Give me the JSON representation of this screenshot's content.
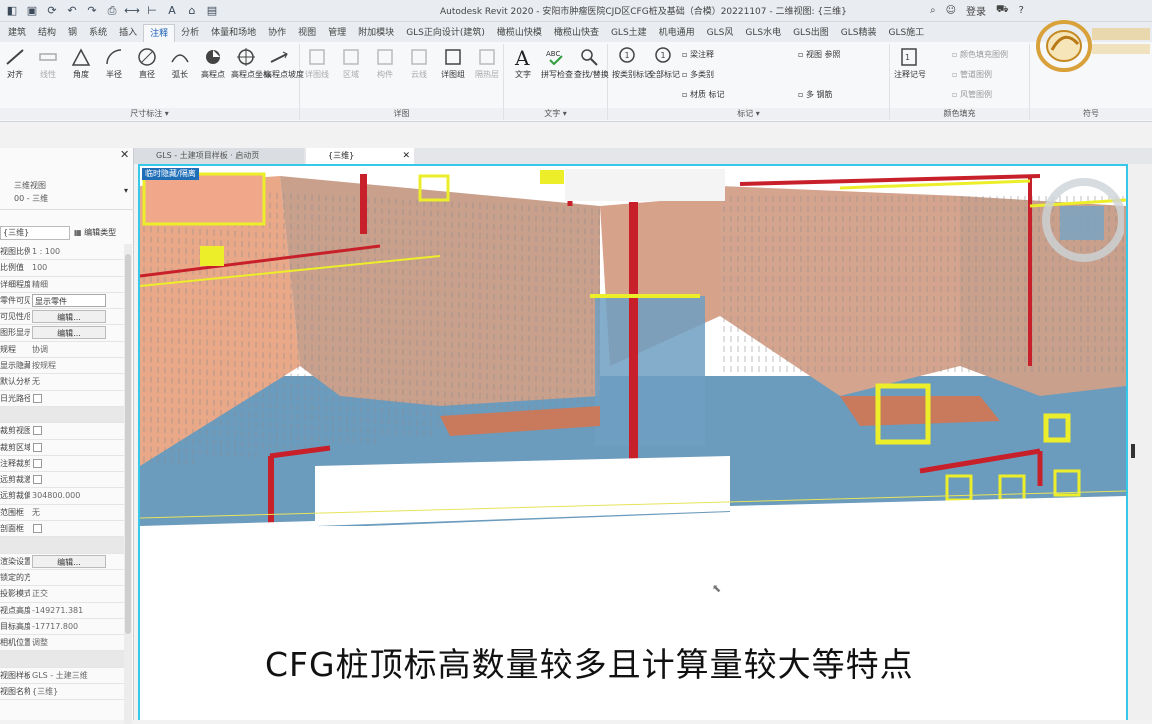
{
  "window": {
    "title": "Autodesk Revit 2020 - 安阳市肿瘤医院CJD区CFG桩及基础（合模）20221107 - 二维视图: {三维}",
    "user": "登录"
  },
  "ribbon_tabs": [
    "建筑",
    "结构",
    "钢",
    "系统",
    "插入",
    "注释",
    "分析",
    "体量和场地",
    "协作",
    "视图",
    "管理",
    "附加模块",
    "GLS正向设计(建筑)",
    "橄榄山快模",
    "橄榄山快查",
    "GLS土建",
    "机电通用",
    "GLS风",
    "GLS水电",
    "GLS出图",
    "GLS精装",
    "GLS施工"
  ],
  "active_tab": "注释",
  "ribbon": {
    "dimension_group": {
      "label": "尺寸标注 ▾",
      "buttons": [
        "对齐",
        "线性",
        "角度",
        "半径",
        "直径",
        "弧长",
        "高程点",
        "高程点坐标",
        "高程点坡度"
      ]
    },
    "detail_group": {
      "label": "详图",
      "buttons": [
        "详图线",
        "区域",
        "构件",
        "云线",
        "详图组",
        "隔热层"
      ]
    },
    "text_group": {
      "label": "文字 ▾",
      "buttons": [
        "文字",
        "拼写检查",
        "查找/替换"
      ]
    },
    "tag_group": {
      "label": "标记 ▾",
      "buttons": [
        "按类别标记",
        "全部标记"
      ],
      "small": [
        "梁注释",
        "多类别",
        "材质 标记",
        "视图 参照",
        "多 钢筋"
      ]
    },
    "notes_group": {
      "label": "颜色填充",
      "buttons": [
        "注释记号"
      ],
      "small": [
        "颜色填充图例",
        "管道图例",
        "风管图例"
      ]
    },
    "symbol_group": {
      "label": "符号"
    }
  },
  "properties": {
    "type_name": "三维视图",
    "type_sub": "00 - 三维",
    "filter": "{三维}",
    "edit_type": "编辑类型",
    "rows": [
      {
        "k": "视图比例",
        "v": "1 : 100",
        "kind": "text"
      },
      {
        "k": "比例值",
        "v": "100",
        "kind": "text"
      },
      {
        "k": "详细程度",
        "v": "精细",
        "kind": "text"
      },
      {
        "k": "零件可见性",
        "v": "显示零件",
        "kind": "box"
      },
      {
        "k": "可见性/图形替换",
        "v": "编辑...",
        "kind": "btn"
      },
      {
        "k": "图形显示选项",
        "v": "编辑...",
        "kind": "btn"
      },
      {
        "k": "规程",
        "v": "协调",
        "kind": "text"
      },
      {
        "k": "显示隐藏线",
        "v": "按规程",
        "kind": "text"
      },
      {
        "k": "默认分析显示",
        "v": "无",
        "kind": "text"
      },
      {
        "k": "日光路径",
        "v": "",
        "kind": "check"
      },
      {
        "k": "",
        "v": "",
        "kind": "section"
      },
      {
        "k": "裁剪视图",
        "v": "",
        "kind": "check"
      },
      {
        "k": "裁剪区域可见",
        "v": "",
        "kind": "check"
      },
      {
        "k": "注释裁剪",
        "v": "",
        "kind": "check"
      },
      {
        "k": "远剪裁激活",
        "v": "",
        "kind": "check"
      },
      {
        "k": "远剪裁偏移",
        "v": "304800.000",
        "kind": "text"
      },
      {
        "k": "范围框",
        "v": "无",
        "kind": "text"
      },
      {
        "k": "剖面框",
        "v": "",
        "kind": "check"
      },
      {
        "k": "",
        "v": "",
        "kind": "section"
      },
      {
        "k": "渲染设置",
        "v": "编辑...",
        "kind": "btn"
      },
      {
        "k": "锁定的方向",
        "v": "",
        "kind": "text"
      },
      {
        "k": "投影模式",
        "v": "正交",
        "kind": "text"
      },
      {
        "k": "视点高度",
        "v": "-149271.381",
        "kind": "text"
      },
      {
        "k": "目标高度",
        "v": "-17717.800",
        "kind": "text"
      },
      {
        "k": "相机位置",
        "v": "调整",
        "kind": "text"
      },
      {
        "k": "",
        "v": "",
        "kind": "section"
      },
      {
        "k": "视图样板",
        "v": "GLS - 土建三维",
        "kind": "text"
      },
      {
        "k": "视图名称",
        "v": "{三维}",
        "kind": "text"
      }
    ]
  },
  "view_tabs": [
    {
      "label": "GLS - 土建项目样板 · 启动页",
      "active": false
    },
    {
      "label": "{三维}",
      "active": true
    }
  ],
  "viewport": {
    "label": "临时隐藏/隔离",
    "caption": "CFG桩顶标高数量较多且计算量较大等特点"
  },
  "colors": {
    "accent": "#35c8e8",
    "soil": "#f1a88a",
    "pile_gray": "#b9b9b9",
    "ground_blue": "#5b8fb5",
    "beam_red": "#c8202a",
    "marker_yellow": "#ecee2a"
  }
}
